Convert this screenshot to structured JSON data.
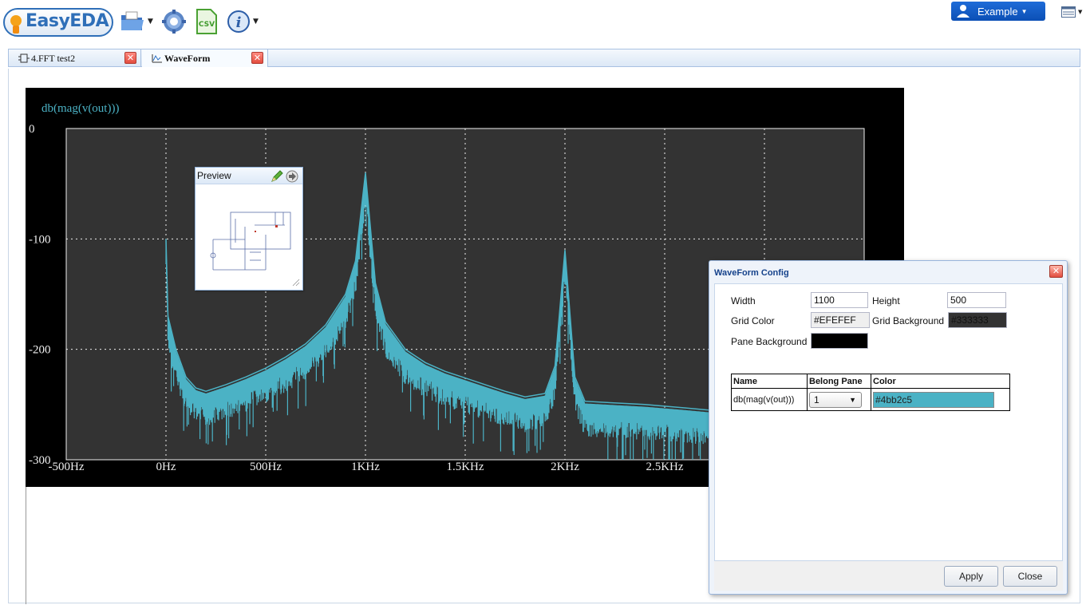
{
  "toolbar": {
    "logo_text": "EasyEDA",
    "csv_label": "CSV",
    "user_label": "Example"
  },
  "tabs": [
    {
      "label": "4.FFT test2",
      "active": false
    },
    {
      "label": "WaveForm",
      "active": true
    }
  ],
  "chart_data": {
    "type": "line",
    "series": [
      {
        "name": "db(mag(v(out)))",
        "color": "#4bb2c5"
      }
    ],
    "xlabel": "",
    "ylabel": "",
    "x_ticks": [
      "-500Hz",
      "0Hz",
      "500Hz",
      "1KHz",
      "1.5KHz",
      "2KHz",
      "2.5KHz"
    ],
    "x_tick_values": [
      -500,
      0,
      500,
      1000,
      1500,
      2000,
      2500
    ],
    "y_ticks": [
      "0",
      "-100",
      "-200",
      "-300"
    ],
    "y_tick_values": [
      0,
      -100,
      -200,
      -300
    ],
    "xlim": [
      -500,
      3500
    ],
    "ylim": [
      -300,
      0
    ],
    "grid": true,
    "pane_background": "#000000",
    "grid_background": "#333333",
    "grid_color": "#EFEFEF",
    "points": [
      [
        0,
        -100
      ],
      [
        10,
        -170
      ],
      [
        50,
        -200
      ],
      [
        100,
        -225
      ],
      [
        150,
        -235
      ],
      [
        200,
        -238
      ],
      [
        300,
        -232
      ],
      [
        400,
        -225
      ],
      [
        500,
        -217
      ],
      [
        600,
        -207
      ],
      [
        700,
        -195
      ],
      [
        800,
        -178
      ],
      [
        900,
        -150
      ],
      [
        950,
        -120
      ],
      [
        1000,
        -40
      ],
      [
        1050,
        -140
      ],
      [
        1100,
        -175
      ],
      [
        1200,
        -200
      ],
      [
        1300,
        -212
      ],
      [
        1400,
        -220
      ],
      [
        1500,
        -226
      ],
      [
        1600,
        -232
      ],
      [
        1700,
        -238
      ],
      [
        1800,
        -243
      ],
      [
        1900,
        -240
      ],
      [
        1950,
        -215
      ],
      [
        2000,
        -110
      ],
      [
        2050,
        -225
      ],
      [
        2100,
        -247
      ],
      [
        2200,
        -248
      ],
      [
        2400,
        -250
      ],
      [
        2600,
        -253
      ],
      [
        2720,
        -255
      ]
    ]
  },
  "preview": {
    "title": "Preview"
  },
  "dialog": {
    "title": "WaveForm Config",
    "width_label": "Width",
    "width_value": "1100",
    "height_label": "Height",
    "height_value": "500",
    "grid_color_label": "Grid Color",
    "grid_color_value": "#EFEFEF",
    "grid_bg_label": "Grid Background",
    "grid_bg_value": "#333333",
    "pane_bg_label": "Pane Background",
    "pane_bg_value": "",
    "table_headers": [
      "Name",
      "Belong Pane",
      "Color"
    ],
    "rows": [
      {
        "name": "db(mag(v(out)))",
        "pane": "1",
        "color": "#4bb2c5"
      }
    ],
    "apply_label": "Apply",
    "close_label": "Close"
  }
}
